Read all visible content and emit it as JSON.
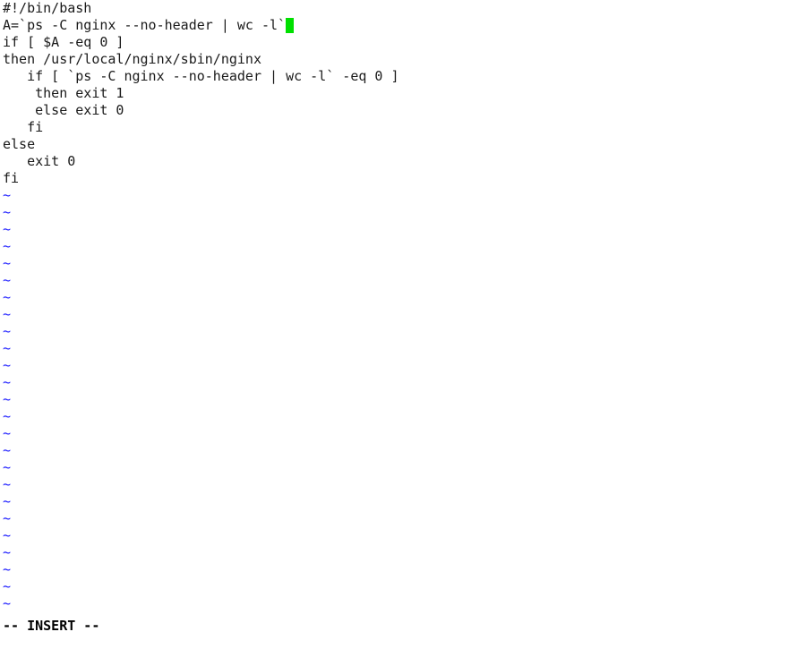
{
  "editor": {
    "name": "vim",
    "filetype": "bash-script",
    "background_color": "#ffffff",
    "text_color": "#1a1a1a",
    "filler_color": "#1414ff",
    "cursor_color": "#00e000",
    "filler_char": "~",
    "filler_line_count": 25
  },
  "buffer": {
    "lines": [
      "#!/bin/bash",
      "A=`ps -C nginx --no-header | wc -l`",
      "if [ $A -eq 0 ]",
      "then /usr/local/nginx/sbin/nginx",
      "   if [ `ps -C nginx --no-header | wc -l` -eq 0 ]",
      "    then exit 1",
      "    else exit 0",
      "   fi",
      "else",
      "   exit 0",
      "fi"
    ],
    "cursor": {
      "line_index": 1,
      "column": 35,
      "shape": "block"
    }
  },
  "status": {
    "mode_text": "-- INSERT --"
  }
}
